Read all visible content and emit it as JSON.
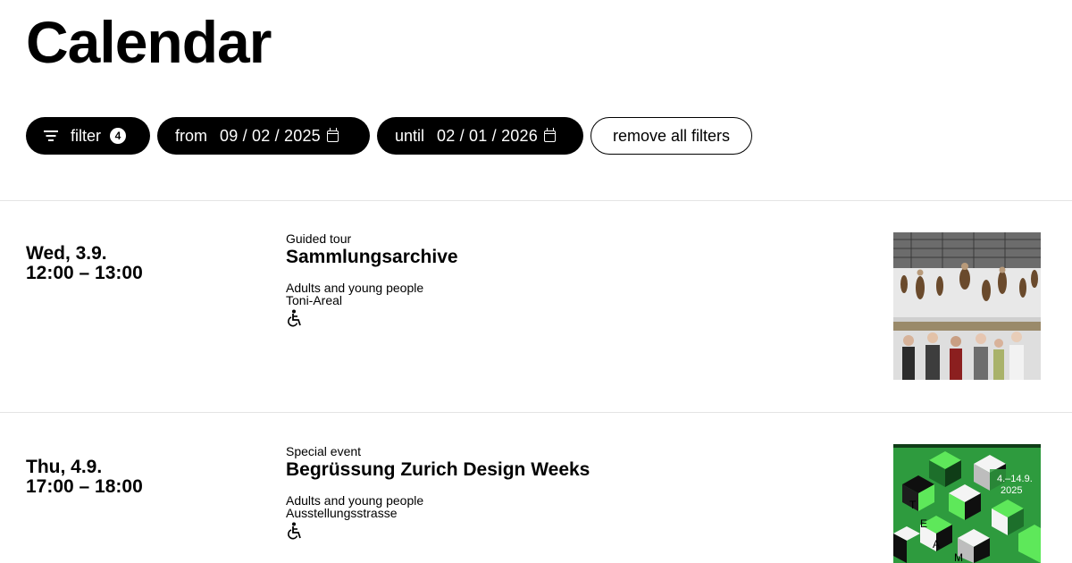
{
  "header": {
    "title": "Calendar"
  },
  "filters": {
    "filter_label": "filter",
    "filter_count": "4",
    "from_label": "from",
    "from_value": "09 / 02 / 2025",
    "until_label": "until",
    "until_value": "02 / 01 / 2026",
    "remove_label": "remove all filters"
  },
  "events": [
    {
      "day": "Wed, 3.9.",
      "time": "12:00 – 13:00",
      "category": "Guided tour",
      "title": "Sammlungsarchive",
      "audience": "Adults and young people",
      "location": "Toni-Areal",
      "accessibility_icon": "wheelchair-icon"
    },
    {
      "day": "Thu, 4.9.",
      "time": "17:00 – 18:00",
      "category": "Special event",
      "title": "Begrüssung Zurich Design Weeks",
      "audience": "Adults and young people",
      "location": "Ausstellungsstrasse",
      "accessibility_icon": "wheelchair-icon",
      "poster_text": {
        "dates": "4.–14.9.",
        "year": "2025",
        "letters": [
          "T",
          "E",
          "A",
          "M"
        ]
      }
    }
  ],
  "colors": {
    "poster_green": "#2e9b3e",
    "poster_bright": "#5ee85a",
    "poster_dark": "#0f3d17"
  }
}
